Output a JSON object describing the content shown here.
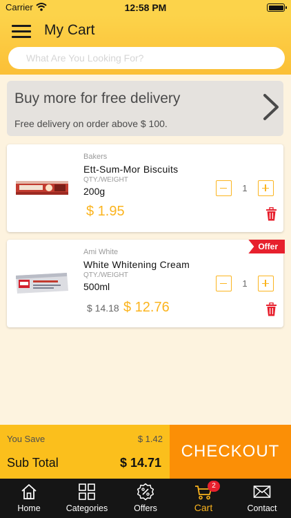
{
  "status_bar": {
    "carrier": "Carrier",
    "time": "12:58 PM"
  },
  "header": {
    "title": "My Cart",
    "search_placeholder": "What Are You Looking For?"
  },
  "banner": {
    "title": "Buy more for free delivery",
    "subtitle": "Free delivery on order above $ 100."
  },
  "cart_items": [
    {
      "brand": "Bakers",
      "name": "Ett-Sum-Mor Biscuits",
      "qty_label": "QTY./WEIGHT",
      "weight": "200g",
      "price": "$ 1.95",
      "old_price": "",
      "quantity": "1",
      "offer": ""
    },
    {
      "brand": "Ami White",
      "name": "White Whitening Cream",
      "qty_label": "QTY./WEIGHT",
      "weight": "500ml",
      "price": "$ 12.76",
      "old_price": "$ 14.18",
      "quantity": "1",
      "offer": "Offer"
    }
  ],
  "summary": {
    "you_save_label": "You Save",
    "you_save_value": "$ 1.42",
    "subtotal_label": "Sub Total",
    "subtotal_value": "$ 14.71"
  },
  "checkout_label": "CHECKOUT",
  "tabs": [
    {
      "label": "Home",
      "icon": "home-icon"
    },
    {
      "label": "Categories",
      "icon": "grid-icon"
    },
    {
      "label": "Offers",
      "icon": "discount-icon"
    },
    {
      "label": "Cart",
      "icon": "cart-icon",
      "badge": "2",
      "active": true
    },
    {
      "label": "Contact",
      "icon": "mail-icon"
    }
  ],
  "colors": {
    "accent": "#fbb41e",
    "header": "#fcd34a",
    "checkout": "#fb8f06",
    "danger": "#e7202d",
    "tabbar": "#151515",
    "background": "#fdf3df"
  }
}
